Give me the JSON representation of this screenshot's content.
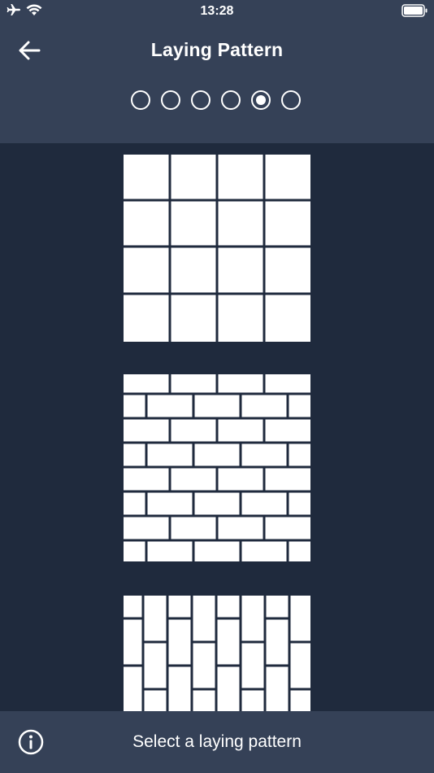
{
  "status_bar": {
    "time": "13:28",
    "icons": [
      "airplane-icon",
      "wifi-icon",
      "battery-icon"
    ]
  },
  "header": {
    "title": "Laying Pattern",
    "back_icon": "arrow-left-icon",
    "steps": [
      {
        "active": false
      },
      {
        "active": false
      },
      {
        "active": false
      },
      {
        "active": false
      },
      {
        "active": true
      },
      {
        "active": false
      }
    ]
  },
  "patterns": [
    {
      "name": "grid"
    },
    {
      "name": "running-bond"
    },
    {
      "name": "vertical-stack-bond"
    }
  ],
  "footer": {
    "text": "Select a laying pattern",
    "info_icon": "info-icon"
  },
  "colors": {
    "header_bg": "#354157",
    "content_bg": "#1f2a3d",
    "tile": "#ffffff"
  }
}
